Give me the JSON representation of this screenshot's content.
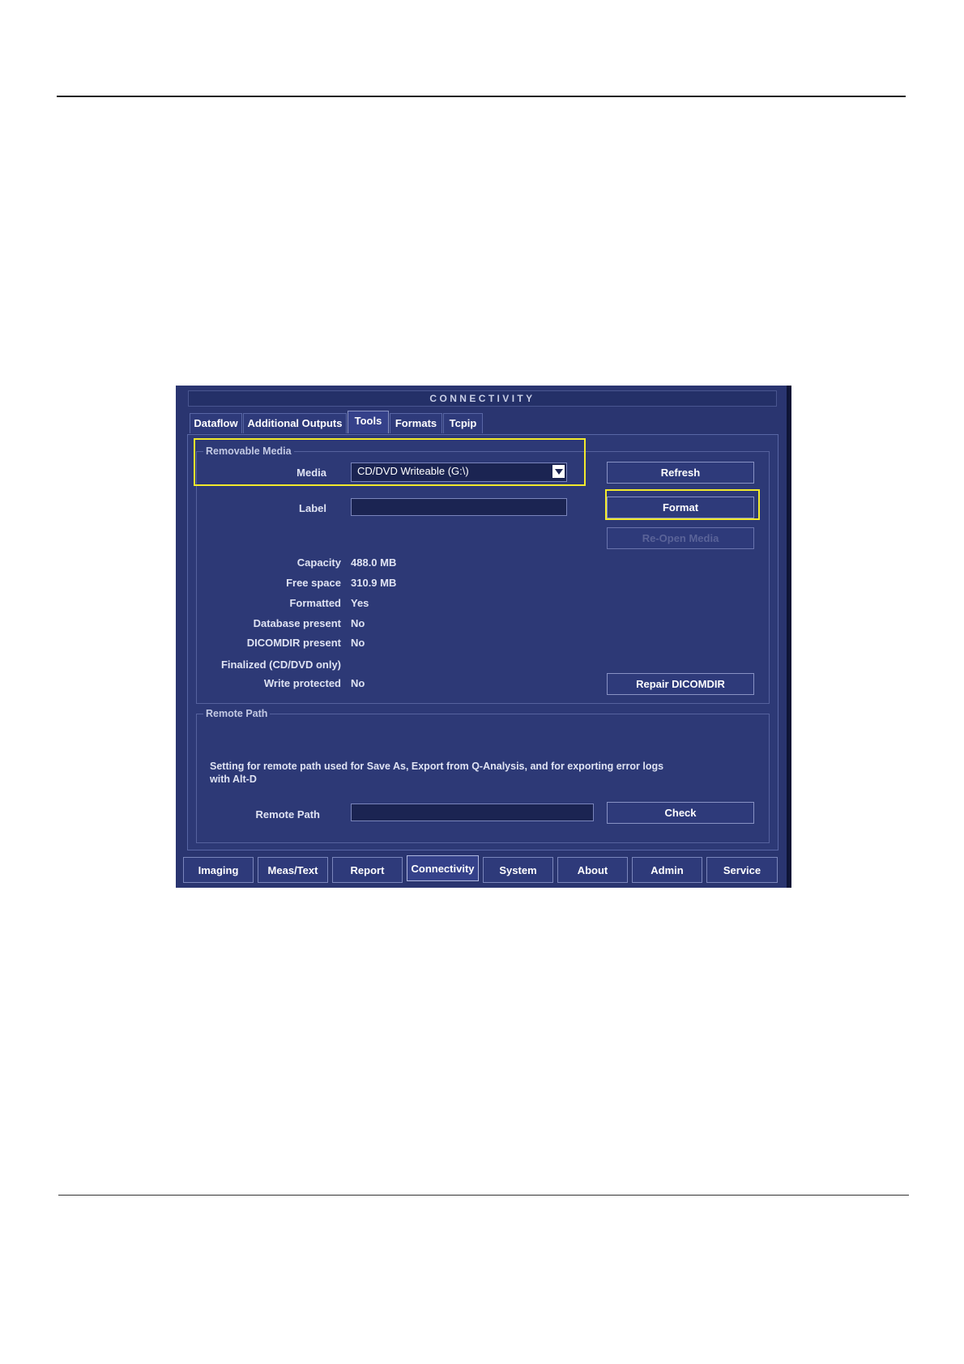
{
  "window": {
    "title": "CONNECTIVITY"
  },
  "tabs": [
    {
      "label": "Dataflow"
    },
    {
      "label": "Additional Outputs"
    },
    {
      "label": "Tools",
      "active": true
    },
    {
      "label": "Formats"
    },
    {
      "label": "Tcpip"
    }
  ],
  "removable_media": {
    "legend": "Removable Media",
    "media_label": "Media",
    "media_value": "CD/DVD Writeable (G:\\)",
    "label_label": "Label",
    "label_value": "",
    "buttons": {
      "refresh": "Refresh",
      "format": "Format",
      "reopen": "Re-Open Media",
      "repair": "Repair DICOMDIR"
    },
    "info": [
      {
        "label": "Capacity",
        "value": "488.0 MB"
      },
      {
        "label": "Free space",
        "value": "310.9 MB"
      },
      {
        "label": "Formatted",
        "value": "Yes"
      },
      {
        "label": "Database present",
        "value": "No"
      },
      {
        "label": "DICOMDIR present",
        "value": "No"
      },
      {
        "label": "Finalized (CD/DVD only)",
        "value": ""
      },
      {
        "label": "Write protected",
        "value": "No"
      }
    ]
  },
  "remote_path": {
    "legend": "Remote Path",
    "description_line1": "Setting for remote path used for Save As, Export from Q-Analysis, and for exporting error logs",
    "description_line2": "with Alt-D",
    "path_label": "Remote Path",
    "path_value": "",
    "check_button": "Check"
  },
  "bottom_tabs": [
    {
      "label": "Imaging"
    },
    {
      "label": "Meas/Text"
    },
    {
      "label": "Report"
    },
    {
      "label": "Connectivity",
      "active": true
    },
    {
      "label": "System"
    },
    {
      "label": "About"
    },
    {
      "label": "Admin"
    },
    {
      "label": "Service"
    }
  ],
  "colors": {
    "highlight": "#f2ea2c",
    "panel_bg": "#2a3570",
    "text": "#ffffff"
  }
}
